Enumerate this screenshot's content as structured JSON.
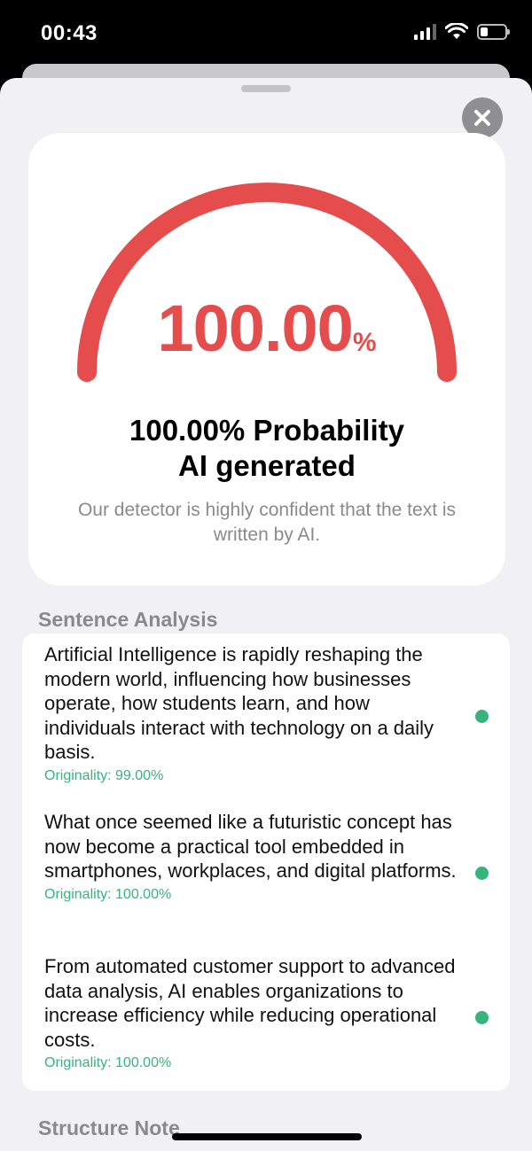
{
  "status": {
    "time": "00:43"
  },
  "result": {
    "percent_value": "100.00",
    "percent_symbol": "%",
    "probability": 1.0,
    "headline_line1": "100.00% Probability",
    "headline_line2": "AI generated",
    "description": "Our detector is highly confident that the text is written by AI.",
    "accent_color": "#e54c4c"
  },
  "sentence_analysis": {
    "title": "Sentence Analysis",
    "items": [
      {
        "text": "Artificial Intelligence is rapidly reshaping the modern world, influencing how businesses operate, how students learn, and how individuals interact with technology on a daily basis.",
        "originality": "Originality: 99.00%"
      },
      {
        "text": "What once seemed like a futuristic concept has now become a practical tool embedded in smartphones, workplaces, and digital platforms.",
        "originality": "Originality: 100.00%"
      },
      {
        "text": "From automated customer support to advanced data analysis, AI enables organizations to increase efficiency while reducing operational costs.",
        "originality": "Originality: 100.00%"
      }
    ],
    "dot_color": "#37b37e"
  },
  "structure_note": {
    "title": "Structure Note"
  }
}
